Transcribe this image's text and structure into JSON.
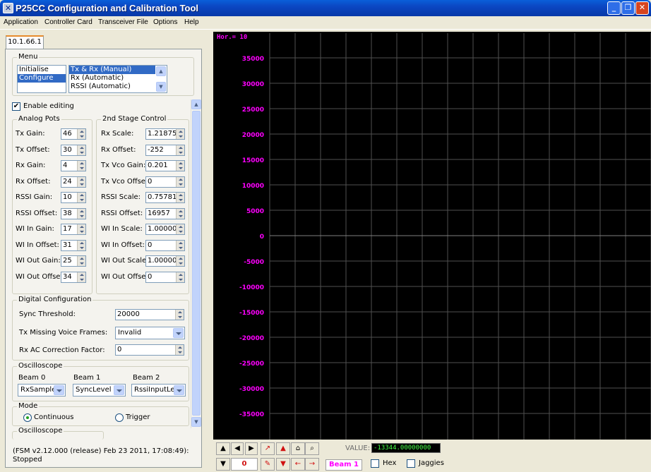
{
  "window": {
    "title": "P25CC Configuration and Calibration Tool"
  },
  "menu": [
    "Application",
    "Controller Card",
    "Transceiver File",
    "Options",
    "Help"
  ],
  "tab": {
    "label": "10.1.66.1"
  },
  "menu_group": {
    "label": "Menu",
    "left_items": [
      "Initialise",
      "Configure"
    ],
    "left_selected": 1,
    "right_items": [
      "Tx & Rx (Manual)",
      "Rx (Automatic)",
      "RSSI (Automatic)"
    ],
    "right_selected": 0
  },
  "enable_editing": {
    "label": "Enable editing",
    "checked": true
  },
  "analog_pots": {
    "label": "Analog Pots",
    "rows": [
      {
        "label": "Tx Gain:",
        "value": "46"
      },
      {
        "label": "Tx Offset:",
        "value": "30"
      },
      {
        "label": "Rx Gain:",
        "value": "4"
      },
      {
        "label": "Rx Offset:",
        "value": "24"
      },
      {
        "label": "RSSI Gain:",
        "value": "10"
      },
      {
        "label": "RSSI Offset:",
        "value": "38"
      },
      {
        "label": "WI In Gain:",
        "value": "17"
      },
      {
        "label": "WI In Offset:",
        "value": "31"
      },
      {
        "label": "WI Out Gain:",
        "value": "25"
      },
      {
        "label": "WI Out Offset:",
        "value": "34"
      }
    ]
  },
  "second_stage": {
    "label": "2nd Stage Control",
    "rows": [
      {
        "label": "Rx Scale:",
        "value": "1.21875"
      },
      {
        "label": "Rx Offset:",
        "value": "-252"
      },
      {
        "label": "Tx Vco Gain:",
        "value": "0.201"
      },
      {
        "label": "Tx Vco Offset:",
        "value": "0"
      },
      {
        "label": "RSSI Scale:",
        "value": "0.75781"
      },
      {
        "label": "RSSI Offset:",
        "value": "16957"
      },
      {
        "label": "WI In Scale:",
        "value": "1.00000"
      },
      {
        "label": "WI In Offset:",
        "value": "0"
      },
      {
        "label": "WI Out Scale:",
        "value": "1.00000"
      },
      {
        "label": "WI Out Offset:",
        "value": "0"
      }
    ]
  },
  "digital_config": {
    "label": "Digital Configuration",
    "sync_threshold_label": "Sync Threshold:",
    "sync_threshold_value": "20000",
    "tx_missing_label": "Tx Missing Voice Frames:",
    "tx_missing_value": "Invalid",
    "rx_ac_label": "Rx AC Correction Factor:",
    "rx_ac_value": "0"
  },
  "oscilloscope": {
    "label": "Oscilloscope",
    "beams": [
      {
        "label": "Beam 0",
        "value": "RxSamples"
      },
      {
        "label": "Beam 1",
        "value": "SyncLevel"
      },
      {
        "label": "Beam 2",
        "value": "RssiInputLev"
      }
    ]
  },
  "mode": {
    "label": "Mode",
    "continuous": "Continuous",
    "trigger": "Trigger",
    "selected": "continuous"
  },
  "oscilloscope2": {
    "label": "Oscilloscope"
  },
  "status": {
    "line1": "(FSM v2.12.000 (release) Feb 23 2011, 17:08:49):",
    "line2": "Stopped"
  },
  "scope": {
    "hor_label": "Hor.= 10",
    "y_ticks": [
      "35000",
      "30000",
      "25000",
      "20000",
      "15000",
      "10000",
      "5000",
      "0",
      "-5000",
      "-10000",
      "-15000",
      "-20000",
      "-25000",
      "-30000",
      "-35000"
    ],
    "label_color": "#ff00ff",
    "grid_color": "#505050"
  },
  "bottom": {
    "value_label": "VALUE:",
    "value": "-13344.00000000",
    "counter": "0",
    "beam": "Beam 1",
    "hex_label": "Hex",
    "jaggies_label": "Jaggies"
  }
}
